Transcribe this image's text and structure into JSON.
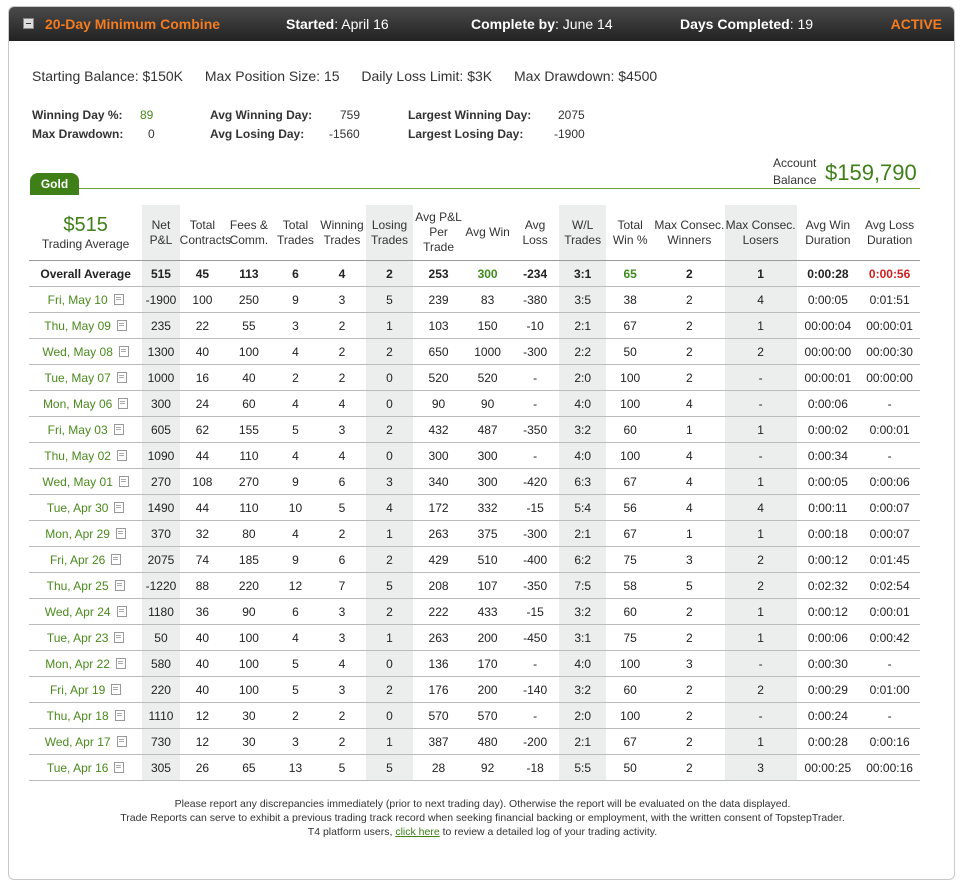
{
  "header": {
    "title": "20-Day Minimum Combine",
    "started_label": "Started",
    "started_value": ": April 16",
    "complete_label": "Complete by",
    "complete_value": ": June 14",
    "days_label": "Days Completed",
    "days_value": ": 19",
    "status": "ACTIVE"
  },
  "params": {
    "starting_balance": "Starting Balance: $150K",
    "max_position": "Max Position Size: 15",
    "daily_loss": "Daily Loss Limit: $3K",
    "max_drawdown": "Max Drawdown: $4500"
  },
  "stats": {
    "winning_day_label": "Winning Day %:",
    "winning_day_value": "89",
    "max_drawdown_label": "Max Drawdown:",
    "max_drawdown_value": "0",
    "avg_winning_label": "Avg Winning Day:",
    "avg_winning_value": "759",
    "avg_losing_label": "Avg Losing Day:",
    "avg_losing_value": "-1560",
    "largest_winning_label": "Largest Winning Day:",
    "largest_winning_value": "2075",
    "largest_losing_label": "Largest Losing Day:",
    "largest_losing_value": "-1900"
  },
  "tab": {
    "label": "Gold"
  },
  "account": {
    "label": "Account Balance",
    "value": "$159,790"
  },
  "table": {
    "trading_average_value": "$515",
    "trading_average_label": "Trading Average",
    "columns": [
      "Net P&L",
      "Total Contracts",
      "Fees & Comm.",
      "Total Trades",
      "Winning Trades",
      "Losing Trades",
      "Avg P&L Per Trade",
      "Avg Win",
      "Avg Loss",
      "W/L Trades",
      "Total Win %",
      "Max Consec. Winners",
      "Max Consec. Losers",
      "Avg Win Duration",
      "Avg Loss Duration"
    ],
    "overall": [
      "Overall Average",
      "515",
      "45",
      "113",
      "6",
      "4",
      "2",
      "253",
      "300",
      "-234",
      "3:1",
      "65",
      "2",
      "1",
      "0:00:28",
      "0:00:56"
    ],
    "rows": [
      [
        "Fri, May 10",
        "-1900",
        "100",
        "250",
        "9",
        "3",
        "5",
        "239",
        "83",
        "-380",
        "3:5",
        "38",
        "2",
        "4",
        "0:00:05",
        "0:01:51"
      ],
      [
        "Thu, May 09",
        "235",
        "22",
        "55",
        "3",
        "2",
        "1",
        "103",
        "150",
        "-10",
        "2:1",
        "67",
        "2",
        "1",
        "00:00:04",
        "00:00:01"
      ],
      [
        "Wed, May 08",
        "1300",
        "40",
        "100",
        "4",
        "2",
        "2",
        "650",
        "1000",
        "-300",
        "2:2",
        "50",
        "2",
        "2",
        "00:00:00",
        "00:00:30"
      ],
      [
        "Tue, May 07",
        "1000",
        "16",
        "40",
        "2",
        "2",
        "0",
        "520",
        "520",
        "-",
        "2:0",
        "100",
        "2",
        "-",
        "00:00:01",
        "00:00:00"
      ],
      [
        "Mon, May 06",
        "300",
        "24",
        "60",
        "4",
        "4",
        "0",
        "90",
        "90",
        "-",
        "4:0",
        "100",
        "4",
        "-",
        "0:00:06",
        "-"
      ],
      [
        "Fri, May 03",
        "605",
        "62",
        "155",
        "5",
        "3",
        "2",
        "432",
        "487",
        "-350",
        "3:2",
        "60",
        "1",
        "1",
        "0:00:02",
        "0:00:01"
      ],
      [
        "Thu, May 02",
        "1090",
        "44",
        "110",
        "4",
        "4",
        "0",
        "300",
        "300",
        "-",
        "4:0",
        "100",
        "4",
        "-",
        "0:00:34",
        "-"
      ],
      [
        "Wed, May 01",
        "270",
        "108",
        "270",
        "9",
        "6",
        "3",
        "340",
        "300",
        "-420",
        "6:3",
        "67",
        "4",
        "1",
        "0:00:05",
        "0:00:06"
      ],
      [
        "Tue, Apr 30",
        "1490",
        "44",
        "110",
        "10",
        "5",
        "4",
        "172",
        "332",
        "-15",
        "5:4",
        "56",
        "4",
        "4",
        "0:00:11",
        "0:00:07"
      ],
      [
        "Mon, Apr 29",
        "370",
        "32",
        "80",
        "4",
        "2",
        "1",
        "263",
        "375",
        "-300",
        "2:1",
        "67",
        "1",
        "1",
        "0:00:18",
        "0:00:07"
      ],
      [
        "Fri, Apr 26",
        "2075",
        "74",
        "185",
        "9",
        "6",
        "2",
        "429",
        "510",
        "-400",
        "6:2",
        "75",
        "3",
        "2",
        "0:00:12",
        "0:01:45"
      ],
      [
        "Thu, Apr 25",
        "-1220",
        "88",
        "220",
        "12",
        "7",
        "5",
        "208",
        "107",
        "-350",
        "7:5",
        "58",
        "5",
        "2",
        "0:02:32",
        "0:02:54"
      ],
      [
        "Wed, Apr 24",
        "1180",
        "36",
        "90",
        "6",
        "3",
        "2",
        "222",
        "433",
        "-15",
        "3:2",
        "60",
        "2",
        "1",
        "0:00:12",
        "0:00:01"
      ],
      [
        "Tue, Apr 23",
        "50",
        "40",
        "100",
        "4",
        "3",
        "1",
        "263",
        "200",
        "-450",
        "3:1",
        "75",
        "2",
        "1",
        "0:00:06",
        "0:00:42"
      ],
      [
        "Mon, Apr 22",
        "580",
        "40",
        "100",
        "5",
        "4",
        "0",
        "136",
        "170",
        "-",
        "4:0",
        "100",
        "3",
        "-",
        "0:00:30",
        "-"
      ],
      [
        "Fri, Apr 19",
        "220",
        "40",
        "100",
        "5",
        "3",
        "2",
        "176",
        "200",
        "-140",
        "3:2",
        "60",
        "2",
        "2",
        "0:00:29",
        "0:01:00"
      ],
      [
        "Thu, Apr 18",
        "1110",
        "12",
        "30",
        "2",
        "2",
        "0",
        "570",
        "570",
        "-",
        "2:0",
        "100",
        "2",
        "-",
        "0:00:24",
        "-"
      ],
      [
        "Wed, Apr 17",
        "730",
        "12",
        "30",
        "3",
        "2",
        "1",
        "387",
        "480",
        "-200",
        "2:1",
        "67",
        "2",
        "1",
        "0:00:28",
        "0:00:16"
      ],
      [
        "Tue, Apr 16",
        "305",
        "26",
        "65",
        "13",
        "5",
        "5",
        "28",
        "92",
        "-18",
        "5:5",
        "50",
        "2",
        "3",
        "00:00:25",
        "00:00:16"
      ]
    ]
  },
  "footer": {
    "line1": "Please report any discrepancies immediately (prior to next trading day). Otherwise the report will be evaluated on the data displayed.",
    "line2": "Trade Reports can serve to exhibit a previous trading track record when seeking financial backing or employment, with the written consent of TopstepTrader.",
    "line3_pre": "T4 platform users, ",
    "link": "click here",
    "line3_post": " to review a detailed log of your trading activity."
  },
  "colors": {
    "accent": "#f47b20",
    "green": "#3e7f17",
    "negative": "#cc2222"
  }
}
